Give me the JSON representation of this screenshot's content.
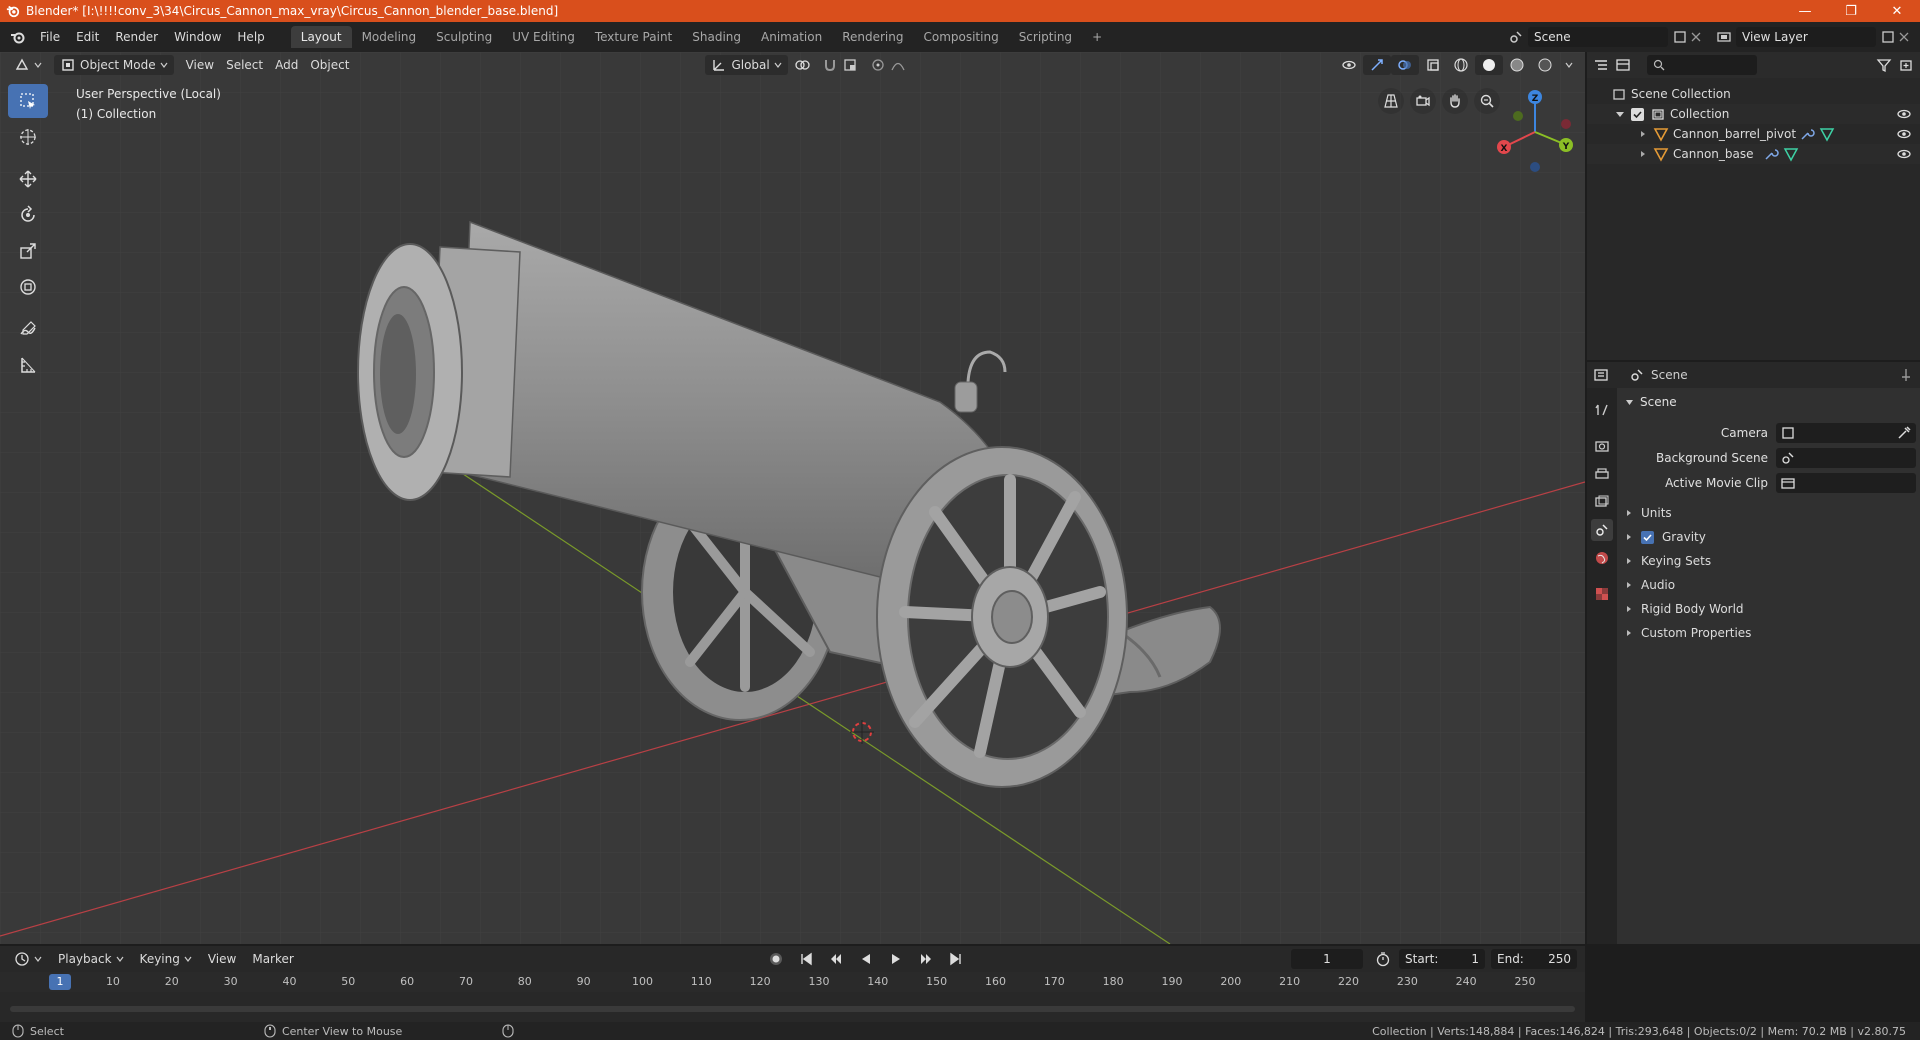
{
  "window": {
    "title": "Blender* [I:\\!!!!conv_3\\34\\Circus_Cannon_max_vray\\Circus_Cannon_blender_base.blend]",
    "minimize": "—",
    "maximize": "❐",
    "close": "✕"
  },
  "menu": [
    "File",
    "Edit",
    "Render",
    "Window",
    "Help"
  ],
  "workspaces": [
    "Layout",
    "Modeling",
    "Sculpting",
    "UV Editing",
    "Texture Paint",
    "Shading",
    "Animation",
    "Rendering",
    "Compositing",
    "Scripting"
  ],
  "add_workspace": "+",
  "scene_selector": "Scene",
  "view_layer_selector": "View Layer",
  "viewport": {
    "mode": "Object Mode",
    "menus": [
      "View",
      "Select",
      "Add",
      "Object"
    ],
    "transform_orientation": "Global",
    "info_line1": "User Perspective (Local)",
    "info_line2": "(1) Collection",
    "axis_labels": {
      "x": "X",
      "y": "Y",
      "z": "Z"
    }
  },
  "outliner": {
    "rows": [
      {
        "label": "Scene Collection"
      },
      {
        "label": "Collection"
      },
      {
        "label": "Cannon_barrel_pivot"
      },
      {
        "label": "Cannon_base"
      }
    ]
  },
  "properties": {
    "header_title": "Scene",
    "panel_title": "Scene",
    "fields": [
      {
        "label": "Camera",
        "value": ""
      },
      {
        "label": "Background Scene",
        "value": ""
      },
      {
        "label": "Active Movie Clip",
        "value": ""
      }
    ],
    "subpanels": [
      "Units",
      "Gravity",
      "Keying Sets",
      "Audio",
      "Rigid Body World",
      "Custom Properties"
    ],
    "gravity_checked": true
  },
  "timeline": {
    "menus": [
      "Playback",
      "Keying",
      "View",
      "Marker"
    ],
    "current_frame": "1",
    "start_label": "Start:",
    "start": "1",
    "end_label": "End:",
    "end": "250",
    "ticks": [
      "1",
      "10",
      "20",
      "30",
      "40",
      "50",
      "60",
      "70",
      "80",
      "90",
      "100",
      "110",
      "120",
      "130",
      "140",
      "150",
      "160",
      "170",
      "180",
      "190",
      "200",
      "210",
      "220",
      "230",
      "240",
      "250"
    ]
  },
  "statusbar": {
    "left_action": "Select",
    "middle_action": "Center View to Mouse",
    "stats": "Collection | Verts:148,884 | Faces:146,824 | Tris:293,648 | Objects:0/2 | Mem: 70.2 MB | v2.80.75"
  },
  "colors": {
    "accent": "#4772b3",
    "titlebar": "#d94f1c",
    "x_axis": "#e2474c",
    "y_axis": "#8bbf25",
    "z_axis": "#3d86e0",
    "mesh": "#9a9a9a",
    "object_icon": "#e49a36"
  }
}
